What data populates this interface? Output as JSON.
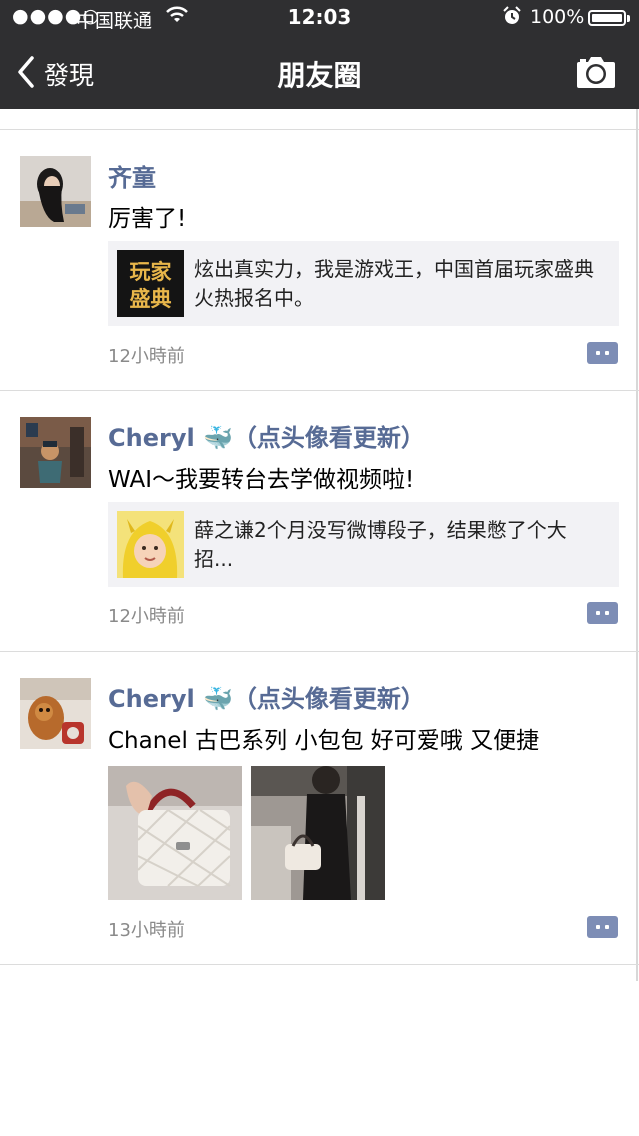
{
  "status_bar": {
    "signal": "●●●●○",
    "carrier": "中国联通",
    "time": "12:03",
    "battery": "100%"
  },
  "nav": {
    "back_label": "發現",
    "title": "朋友圈"
  },
  "posts": [
    {
      "name": "齐童",
      "text": "厉害了!",
      "share_text": "炫出真实力，我是游戏王，中国首届玩家盛典火热报名中。",
      "share_thumb_text": "玩家盛典",
      "time": "12小時前"
    },
    {
      "name": "Cheryl 🐳（点头像看更新）",
      "text": "WAI～我要转台去学做视频啦!",
      "share_text": "薛之谦2个月没写微博段子，结果憋了个大招...",
      "time": "12小時前"
    },
    {
      "name": "Cheryl 🐳（点头像看更新）",
      "text": "Chanel 古巴系列 小包包 好可爱哦  又便捷",
      "time": "13小時前"
    }
  ],
  "colors": {
    "nav_bg": "#2f2f31",
    "name_blue": "#576b95",
    "comment_icon": "#7d8db5",
    "share_bg": "#f2f2f5"
  }
}
